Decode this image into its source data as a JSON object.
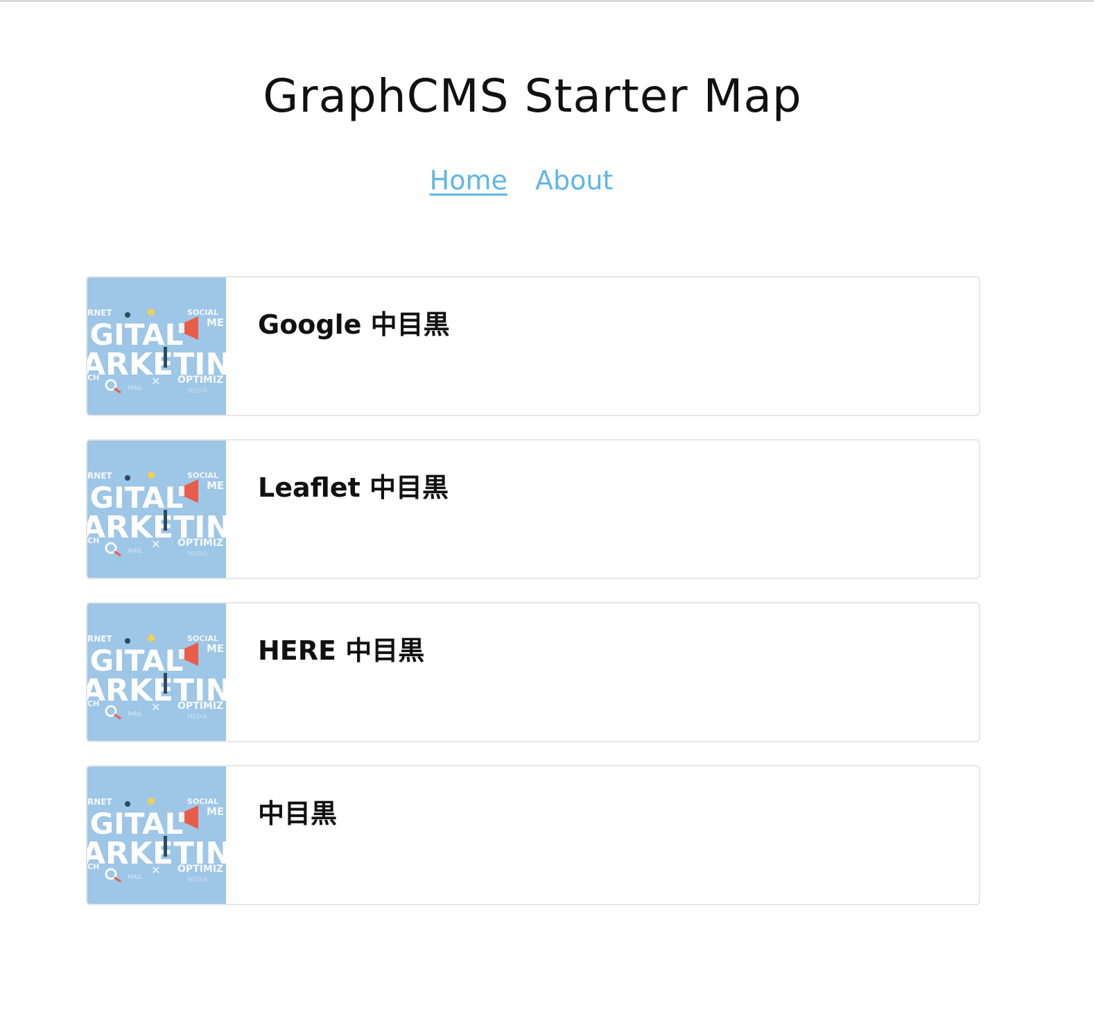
{
  "header": {
    "title": "GraphCMS Starter Map"
  },
  "nav": {
    "items": [
      {
        "label": "Home",
        "active": true
      },
      {
        "label": "About",
        "active": false
      }
    ]
  },
  "places": [
    {
      "title": "Google 中目黒",
      "thumbnail": "digital-marketing-image"
    },
    {
      "title": "Leaflet 中目黒",
      "thumbnail": "digital-marketing-image"
    },
    {
      "title": "HERE 中目黒",
      "thumbnail": "digital-marketing-image"
    },
    {
      "title": "中目黒",
      "thumbnail": "digital-marketing-image"
    }
  ],
  "thumbnail_art": {
    "line1": "IGITAL",
    "line2": "ARKETIN",
    "tag_social": "SOCIAL",
    "tag_me": "ME",
    "tag_rnet": "RNET",
    "tag_optimiz": "OPTIMIZ",
    "tag_ch": "CH",
    "tag_mail": "MAIL",
    "tag_media": "MEDIA"
  },
  "colors": {
    "link": "#5fb6ea",
    "card_border": "#e6e6e6",
    "thumb_bg": "#9ec6e6"
  }
}
